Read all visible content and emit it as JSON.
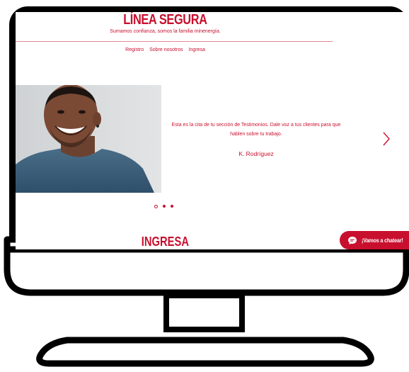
{
  "header": {
    "title": "LÍNEA SEGURA",
    "tagline": "Sumamos confianza, somos la familia minenergía."
  },
  "nav": {
    "items": [
      {
        "label": "Registro"
      },
      {
        "label": "Sobre nosotros"
      },
      {
        "label": "Ingresa"
      }
    ]
  },
  "testimonial": {
    "quote": "Esta es la cita de tu sección de Testimonios. Dale voz a tus clientes para que hablen sobre tu trabajo.",
    "author": "K. Rodríguez",
    "slide_count": 3,
    "active_slide": 1
  },
  "section": {
    "title": "INGRESA"
  },
  "chat": {
    "label": "¡Vamos a chatear!"
  },
  "icons": {
    "next": "chevron-right-icon",
    "chat": "chat-bubble-icon"
  },
  "colors": {
    "brand": "#c8102e",
    "monitor_frame": "#000000",
    "screen": "#ffffff"
  }
}
